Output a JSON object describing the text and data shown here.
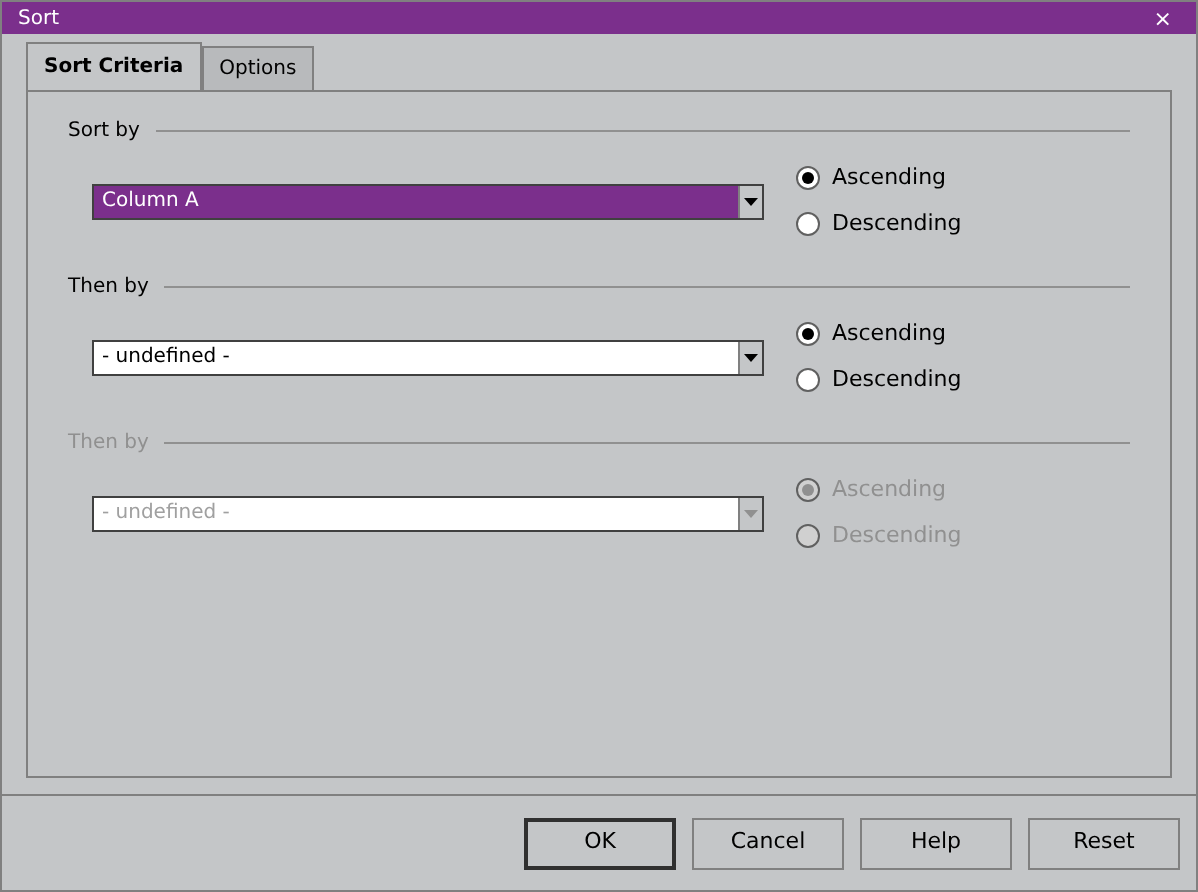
{
  "window": {
    "title": "Sort",
    "close": "×"
  },
  "tabs": [
    {
      "label": "Sort Criteria",
      "selected": true
    },
    {
      "label": "Options",
      "selected": false
    }
  ],
  "keys": [
    {
      "label": "Sort by",
      "value": "Column A",
      "focused": true,
      "disabled": false,
      "order": [
        {
          "label": "Ascending",
          "selected": true
        },
        {
          "label": "Descending",
          "selected": false
        }
      ]
    },
    {
      "label": "Then by",
      "value": "- undefined -",
      "focused": false,
      "disabled": false,
      "order": [
        {
          "label": "Ascending",
          "selected": true
        },
        {
          "label": "Descending",
          "selected": false
        }
      ]
    },
    {
      "label": "Then by",
      "value": "- undefined -",
      "focused": false,
      "disabled": true,
      "order": [
        {
          "label": "Ascending",
          "selected": true
        },
        {
          "label": "Descending",
          "selected": false
        }
      ]
    }
  ],
  "buttons": [
    {
      "label": "OK",
      "default": true
    },
    {
      "label": "Cancel",
      "default": false
    },
    {
      "label": "Help",
      "default": false
    },
    {
      "label": "Reset",
      "default": false
    }
  ]
}
